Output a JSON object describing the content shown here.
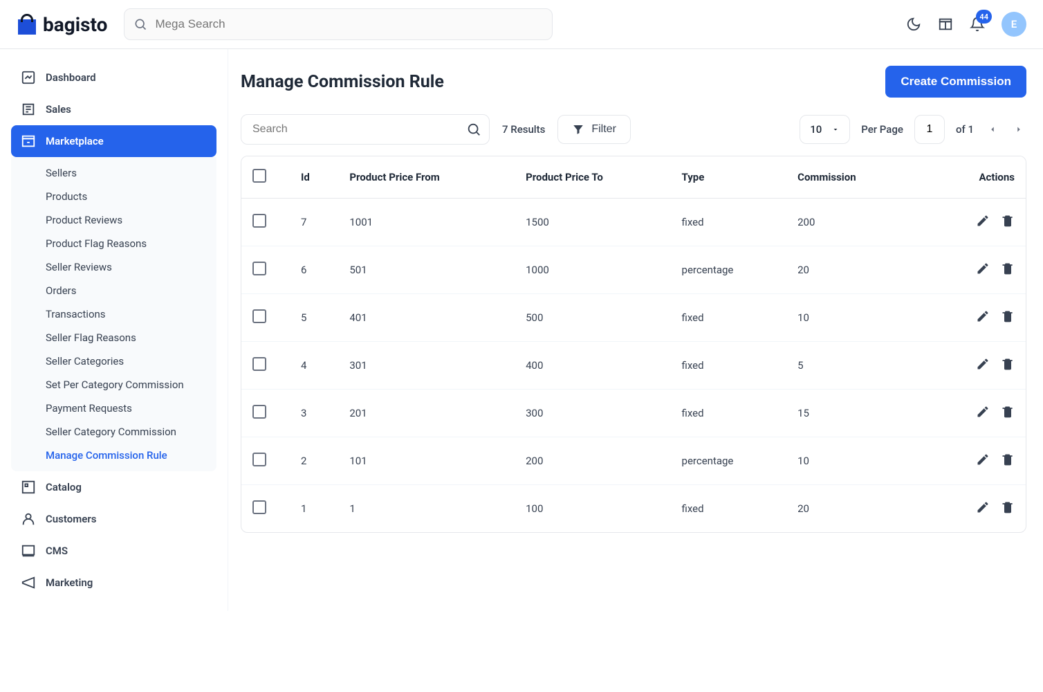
{
  "brand": "bagisto",
  "search": {
    "placeholder": "Mega Search"
  },
  "notifications": {
    "count": "44"
  },
  "avatar": {
    "initial": "E"
  },
  "sidebar": {
    "items": [
      {
        "label": "Dashboard",
        "icon": "dashboard"
      },
      {
        "label": "Sales",
        "icon": "sales"
      },
      {
        "label": "Marketplace",
        "icon": "marketplace",
        "active": true
      },
      {
        "label": "Catalog",
        "icon": "catalog"
      },
      {
        "label": "Customers",
        "icon": "customers"
      },
      {
        "label": "CMS",
        "icon": "cms"
      },
      {
        "label": "Marketing",
        "icon": "marketing"
      }
    ],
    "marketplace_sub": [
      {
        "label": "Sellers"
      },
      {
        "label": "Products"
      },
      {
        "label": "Product Reviews"
      },
      {
        "label": "Product Flag Reasons"
      },
      {
        "label": "Seller Reviews"
      },
      {
        "label": "Orders"
      },
      {
        "label": "Transactions"
      },
      {
        "label": "Seller Flag Reasons"
      },
      {
        "label": "Seller Categories"
      },
      {
        "label": "Set Per Category Commission"
      },
      {
        "label": "Payment Requests"
      },
      {
        "label": "Seller Category Commission"
      },
      {
        "label": "Manage Commission Rule",
        "active": true
      }
    ]
  },
  "page": {
    "title": "Manage Commission Rule",
    "create_label": "Create Commission"
  },
  "toolbar": {
    "search_placeholder": "Search",
    "results_text": "7 Results",
    "filter_label": "Filter",
    "per_page_value": "10",
    "per_page_label": "Per Page",
    "current_page": "1",
    "of_label": "of 1"
  },
  "table": {
    "columns": {
      "id": "Id",
      "price_from": "Product Price From",
      "price_to": "Product Price To",
      "type": "Type",
      "commission": "Commission",
      "actions": "Actions"
    },
    "rows": [
      {
        "id": "7",
        "price_from": "1001",
        "price_to": "1500",
        "type": "fixed",
        "commission": "200"
      },
      {
        "id": "6",
        "price_from": "501",
        "price_to": "1000",
        "type": "percentage",
        "commission": "20"
      },
      {
        "id": "5",
        "price_from": "401",
        "price_to": "500",
        "type": "fixed",
        "commission": "10"
      },
      {
        "id": "4",
        "price_from": "301",
        "price_to": "400",
        "type": "fixed",
        "commission": "5"
      },
      {
        "id": "3",
        "price_from": "201",
        "price_to": "300",
        "type": "fixed",
        "commission": "15"
      },
      {
        "id": "2",
        "price_from": "101",
        "price_to": "200",
        "type": "percentage",
        "commission": "10"
      },
      {
        "id": "1",
        "price_from": "1",
        "price_to": "100",
        "type": "fixed",
        "commission": "20"
      }
    ]
  }
}
